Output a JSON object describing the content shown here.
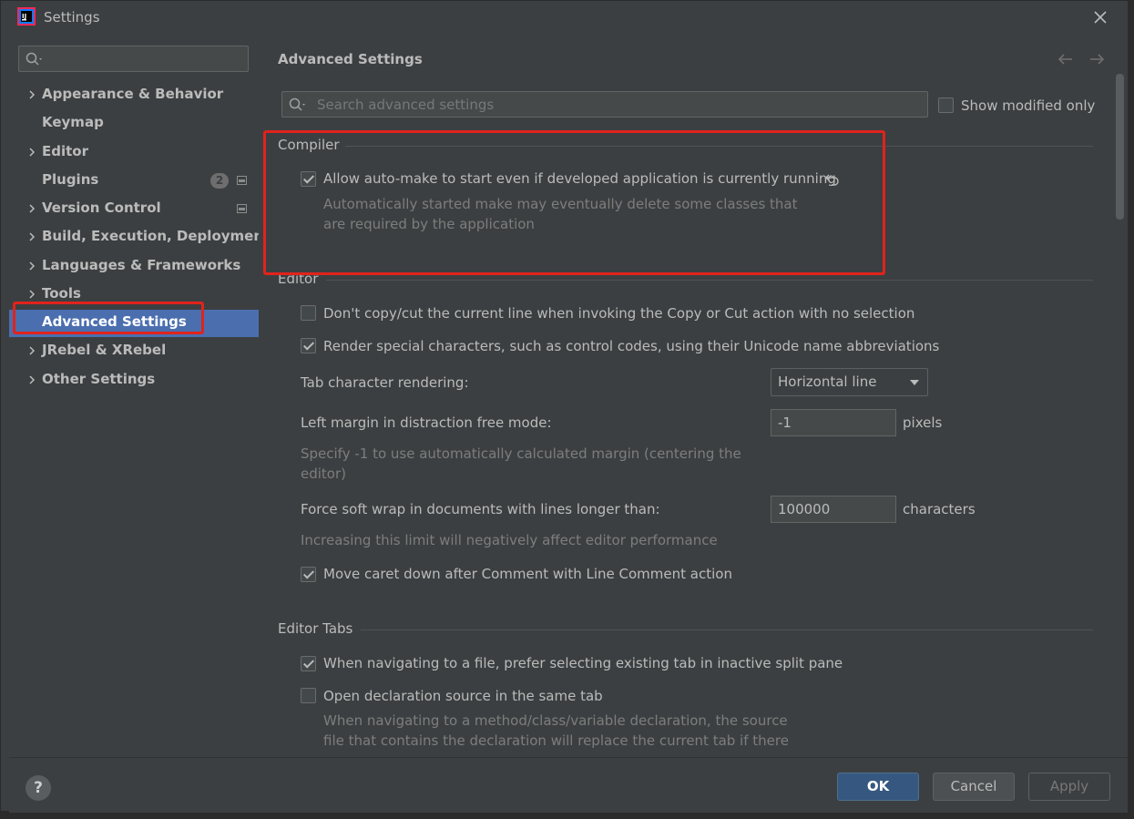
{
  "window": {
    "title": "Settings"
  },
  "sidebar": {
    "search_placeholder": "",
    "items": [
      {
        "label": "Appearance & Behavior",
        "expandable": true
      },
      {
        "label": "Keymap",
        "expandable": false
      },
      {
        "label": "Editor",
        "expandable": true
      },
      {
        "label": "Plugins",
        "expandable": false,
        "badge": "2"
      },
      {
        "label": "Version Control",
        "expandable": true
      },
      {
        "label": "Build, Execution, Deployment",
        "expandable": true
      },
      {
        "label": "Languages & Frameworks",
        "expandable": true
      },
      {
        "label": "Tools",
        "expandable": true
      },
      {
        "label": "Advanced Settings",
        "expandable": false,
        "selected": true
      },
      {
        "label": "JRebel & XRebel",
        "expandable": true
      },
      {
        "label": "Other Settings",
        "expandable": true
      }
    ]
  },
  "main": {
    "title": "Advanced Settings",
    "search_placeholder": "Search advanced settings",
    "show_modified_label": "Show modified only",
    "compiler": {
      "title": "Compiler",
      "auto_make_label": "Allow auto-make to start even if developed application is currently running",
      "auto_make_hint_1": "Automatically started make may eventually delete some classes that",
      "auto_make_hint_2": "are required by the application"
    },
    "editor": {
      "title": "Editor",
      "copy_cut_label": "Don't copy/cut the current line when invoking the Copy or Cut action with no selection",
      "render_special_label": "Render special characters, such as control codes, using their Unicode name abbreviations",
      "tab_rendering_label": "Tab character rendering:",
      "tab_rendering_value": "Horizontal line",
      "left_margin_label": "Left margin in distraction free mode:",
      "left_margin_value": "-1",
      "left_margin_unit": "pixels",
      "left_margin_hint_1": "Specify -1 to use automatically calculated margin (centering the",
      "left_margin_hint_2": "editor)",
      "soft_wrap_label": "Force soft wrap in documents with lines longer than:",
      "soft_wrap_value": "100000",
      "soft_wrap_unit": "characters",
      "soft_wrap_hint": "Increasing this limit will negatively affect editor performance",
      "move_caret_label": "Move caret down after Comment with Line Comment action"
    },
    "editor_tabs": {
      "title": "Editor Tabs",
      "prefer_existing_label": "When navigating to a file, prefer selecting existing tab in inactive split pane",
      "open_same_tab_label": "Open declaration source in the same tab",
      "open_same_tab_hint_1": "When navigating to a method/class/variable declaration, the source",
      "open_same_tab_hint_2": "file that contains the declaration will replace the current tab if there"
    }
  },
  "footer": {
    "help_label": "?",
    "ok_label": "OK",
    "cancel_label": "Cancel",
    "apply_label": "Apply"
  },
  "colors": {
    "background": "#3c3f41",
    "selection": "#4b6eaf",
    "highlight_red": "#e0231c",
    "primary_button": "#365880"
  }
}
